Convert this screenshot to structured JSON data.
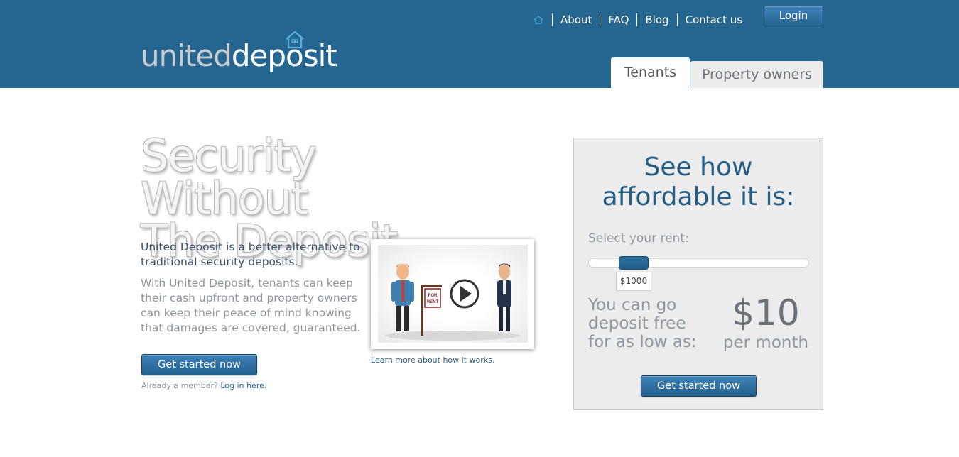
{
  "header": {
    "logo_part1": "united",
    "logo_part2": "deposit",
    "nav": {
      "home_icon": "home-icon",
      "items": [
        "About",
        "FAQ",
        "Blog",
        "Contact us"
      ]
    },
    "login_label": "Login",
    "tabs": [
      "Tenants",
      "Property owners"
    ],
    "colors": {
      "header_bg": "#246690",
      "accent": "#245d85"
    }
  },
  "hero": {
    "headline_line1": "Security Without",
    "headline_line2": "The Deposit.",
    "lead": "United Deposit is a better alternative to traditional security deposits.",
    "body": "With United Deposit, tenants can keep their cash upfront and property owners can keep their peace of mind knowing that damages are covered, guaranteed.",
    "cta_label": "Get started now",
    "member_text": "Already a member?",
    "member_link": "Log in here."
  },
  "video": {
    "sign_text": "FOR RENT",
    "caption": "Learn more about how it works."
  },
  "calculator": {
    "title_line1": "See how",
    "title_line2": "affordable it is:",
    "rent_label": "Select your rent:",
    "rent_value": "$1000",
    "slider_fraction": 0.14,
    "free_text": "You can go deposit free for as low as:",
    "price": "$10",
    "per_month": "per month",
    "cta_label": "Get started now"
  }
}
